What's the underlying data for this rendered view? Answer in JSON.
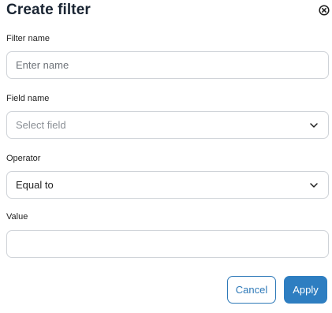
{
  "dialog": {
    "title": "Create filter",
    "close_icon": "close-circle-icon"
  },
  "fields": {
    "filter_name": {
      "label": "Filter name",
      "placeholder": "Enter name",
      "value": ""
    },
    "field_name": {
      "label": "Field name",
      "placeholder": "Select field",
      "icon": "chevron-down-icon"
    },
    "operator": {
      "label": "Operator",
      "value": "Equal to",
      "icon": "chevron-down-icon"
    },
    "value": {
      "label": "Value",
      "value": ""
    }
  },
  "actions": {
    "cancel_label": "Cancel",
    "apply_label": "Apply"
  },
  "colors": {
    "accent": "#2e7ec1",
    "border": "#cfd3d8",
    "title": "#1a2533"
  }
}
